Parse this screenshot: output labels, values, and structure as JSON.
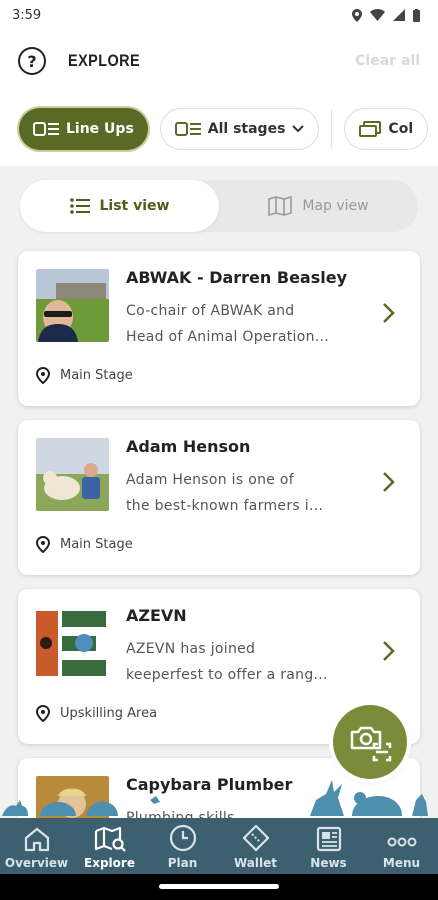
{
  "status_bar": {
    "time": "3:59"
  },
  "header": {
    "title": "EXPLORE",
    "clear_all": "Clear all"
  },
  "filters": [
    {
      "label": "Line Ups",
      "active": true
    },
    {
      "label": "All stages",
      "active": false
    },
    {
      "label": "Col",
      "active": false
    }
  ],
  "view_toggle": {
    "list": "List view",
    "map": "Map view"
  },
  "cards": [
    {
      "title": "ABWAK - Darren Beasley",
      "desc_line1": "Co-chair of ABWAK and",
      "desc_line2": "Head of Animal Operation...",
      "location": "Main Stage"
    },
    {
      "title": "Adam Henson",
      "desc_line1": "Adam Henson is one of",
      "desc_line2": "the best-known farmers i...",
      "location": "Main Stage"
    },
    {
      "title": "AZEVN",
      "desc_line1": "AZEVN has joined",
      "desc_line2": "keeperfest to offer a rang...",
      "location": "Upskilling Area"
    },
    {
      "title": "Capybara Plumber",
      "desc_line1": "Plumbing skills",
      "desc_line2": "",
      "location": ""
    }
  ],
  "bottom_nav": [
    {
      "label": "Overview",
      "icon": "home-icon"
    },
    {
      "label": "Explore",
      "icon": "map-search-icon",
      "active": true
    },
    {
      "label": "Plan",
      "icon": "clock-icon"
    },
    {
      "label": "Wallet",
      "icon": "ticket-icon"
    },
    {
      "label": "News",
      "icon": "newspaper-icon"
    },
    {
      "label": "Menu",
      "icon": "more-icon"
    }
  ],
  "colors": {
    "accent": "#586a24",
    "fab": "#7a8b3a",
    "nav": "#3d6070"
  }
}
